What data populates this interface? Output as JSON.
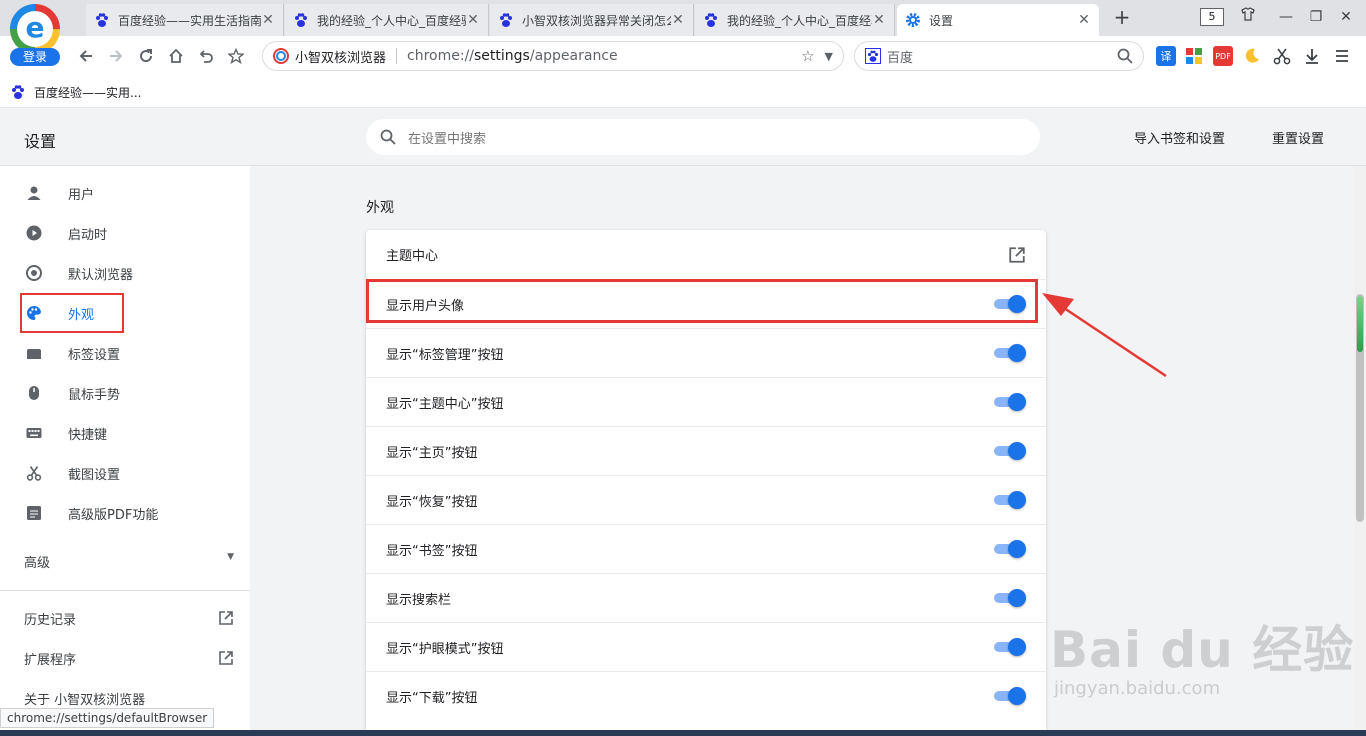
{
  "tabs": [
    {
      "title": "百度经验——实用生活指南"
    },
    {
      "title": "我的经验_个人中心_百度经验"
    },
    {
      "title": "小智双核浏览器异常关闭怎么办"
    },
    {
      "title": "我的经验_个人中心_百度经验"
    },
    {
      "title": "设置",
      "active": true
    }
  ],
  "logo": {
    "login_label": "登录"
  },
  "tab_count": "5",
  "omnibox": {
    "site_name": "小智双核浏览器",
    "url_prefix": "chrome://",
    "url_host": "settings",
    "url_path": "/appearance"
  },
  "search_engine": {
    "name": "百度"
  },
  "extensions": [
    {
      "icon": "translate-icon",
      "label": "译"
    },
    {
      "icon": "apps-grid-icon"
    },
    {
      "icon": "pdf-icon",
      "label": "PDF"
    },
    {
      "icon": "night-mode-icon"
    },
    {
      "icon": "scissors-icon"
    },
    {
      "icon": "download-icon"
    },
    {
      "icon": "menu-icon"
    }
  ],
  "bookmarks": [
    {
      "label": "百度经验——实用..."
    }
  ],
  "header": {
    "title": "设置",
    "search_placeholder": "在设置中搜索",
    "import_label": "导入书签和设置",
    "reset_label": "重置设置"
  },
  "sidebar": {
    "items": [
      {
        "label": "用户",
        "icon": "person-icon"
      },
      {
        "label": "启动时",
        "icon": "power-icon"
      },
      {
        "label": "默认浏览器",
        "icon": "browser-icon"
      },
      {
        "label": "外观",
        "icon": "palette-icon",
        "active": true
      },
      {
        "label": "标签设置",
        "icon": "tab-icon"
      },
      {
        "label": "鼠标手势",
        "icon": "mouse-icon"
      },
      {
        "label": "快捷键",
        "icon": "keyboard-icon"
      },
      {
        "label": "截图设置",
        "icon": "scissors-icon"
      },
      {
        "label": "高级版PDF功能",
        "icon": "pdf-icon"
      }
    ],
    "advanced_label": "高级",
    "links": [
      {
        "label": "历史记录"
      },
      {
        "label": "扩展程序"
      },
      {
        "label": "关于 小智双核浏览器"
      }
    ]
  },
  "main": {
    "section_title": "外观",
    "rows": [
      {
        "label": "主题中心",
        "type": "link"
      },
      {
        "label": "显示用户头像",
        "type": "toggle",
        "on": true
      },
      {
        "label": "显示“标签管理”按钮",
        "type": "toggle",
        "on": true
      },
      {
        "label": "显示“主题中心”按钮",
        "type": "toggle",
        "on": true
      },
      {
        "label": "显示“主页”按钮",
        "type": "toggle",
        "on": true
      },
      {
        "label": "显示“恢复”按钮",
        "type": "toggle",
        "on": true
      },
      {
        "label": "显示“书签”按钮",
        "type": "toggle",
        "on": true
      },
      {
        "label": "显示搜索栏",
        "type": "toggle",
        "on": true
      },
      {
        "label": "显示“护眼模式”按钮",
        "type": "toggle",
        "on": true
      },
      {
        "label": "显示“下载”按钮",
        "type": "toggle",
        "on": true
      }
    ]
  },
  "status_bar": {
    "text": "chrome://settings/defaultBrowser"
  },
  "watermark": {
    "brand": "Bai du 经验",
    "url": "jingyan.baidu.com"
  },
  "colors": {
    "accent": "#1a73e8",
    "highlight_red": "#e53935",
    "toggle_track": "#8ab4f8"
  }
}
